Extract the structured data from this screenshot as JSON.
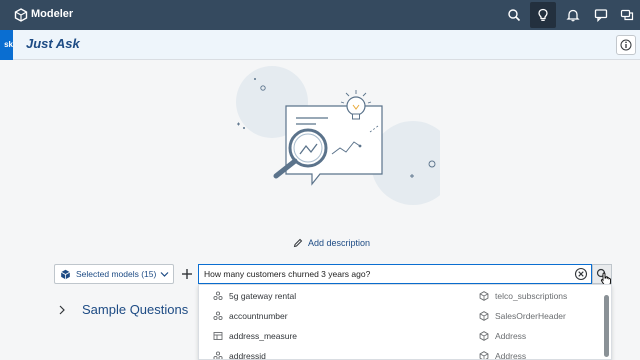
{
  "shell": {
    "app_title": "Modeler",
    "icons": [
      "cube-icon",
      "search-icon",
      "lightbulb-icon",
      "bell-icon",
      "chat-icon",
      "feedback-icon"
    ]
  },
  "header": {
    "tab_stub": "sk",
    "title": "Just Ask"
  },
  "add_description": "Add description",
  "models_selector": {
    "label": "Selected models (15)"
  },
  "search": {
    "value": "How many customers churned 3 years ago?"
  },
  "sample_questions": "Sample Questions",
  "suggestions": [
    {
      "term": "5g gateway rental",
      "term_icon": "dimension-icon",
      "model": "telco_subscriptions"
    },
    {
      "term": "accountnumber",
      "term_icon": "dimension-icon",
      "model": "SalesOrderHeader"
    },
    {
      "term": "address_measure",
      "term_icon": "measure-icon",
      "model": "Address"
    },
    {
      "term": "addressid",
      "term_icon": "dimension-icon",
      "model": "Address"
    }
  ],
  "colors": {
    "shell": "#354a5f",
    "accent": "#0a6ed1",
    "title": "#1d4b84"
  }
}
